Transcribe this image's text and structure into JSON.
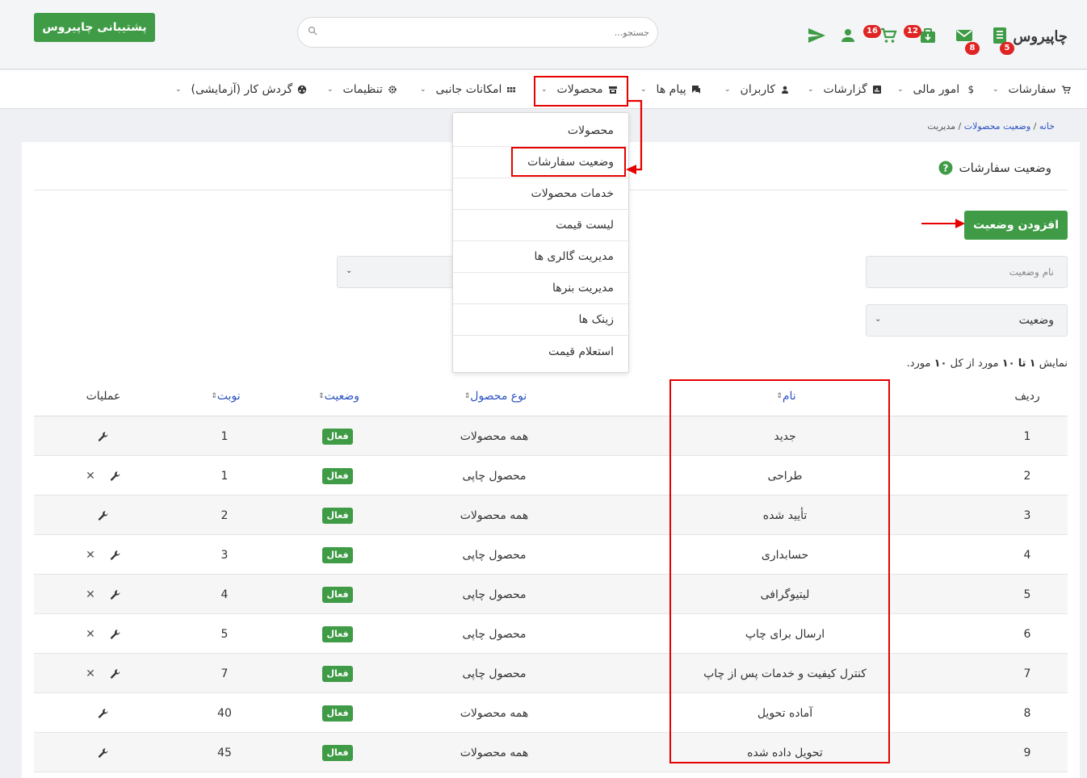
{
  "header": {
    "support_label": "پشتیبانی چاپیروس",
    "search_placeholder": "جستجو...",
    "logo_text": "چاپیروس",
    "badges": {
      "cart": "16",
      "orders_box": "12",
      "mail": "8",
      "invoices": "5"
    }
  },
  "nav": {
    "items": [
      {
        "label": "سفارشات"
      },
      {
        "label": "امور مالی"
      },
      {
        "label": "گزارشات"
      },
      {
        "label": "کاربران"
      },
      {
        "label": "پیام ها"
      },
      {
        "label": "محصولات"
      },
      {
        "label": "امکانات جانبی"
      },
      {
        "label": "تنظیمات"
      },
      {
        "label": "گردش کار (آزمایشی)"
      }
    ]
  },
  "dropdown": {
    "items": [
      {
        "label": "محصولات"
      },
      {
        "label": "وضعیت سفارشات"
      },
      {
        "label": "خدمات محصولات"
      },
      {
        "label": "لیست قیمت"
      },
      {
        "label": "مدیریت گالری ها"
      },
      {
        "label": "مدیریت بنرها"
      },
      {
        "label": "زینک ها"
      },
      {
        "label": "استعلام قیمت"
      }
    ]
  },
  "breadcrumb": {
    "home": "خانه",
    "section": "وضعیت محصولات",
    "current": "مدیریت",
    "sep": "/"
  },
  "page": {
    "title": "وضعیت سفارشات",
    "add_button": "افزودن وضعیت"
  },
  "filters": {
    "name_placeholder": "نام وضعیت",
    "status_label": "وضعیت"
  },
  "summary": {
    "prefix": "نمایش",
    "from": "۱",
    "to_word": "تا",
    "to": "۱۰",
    "mid": "مورد از کل",
    "total": "۱۰",
    "suffix": "مورد."
  },
  "table": {
    "headers": {
      "row": "ردیف",
      "name": "نام",
      "type": "نوع محصول",
      "status": "وضعیت",
      "turn": "نوبت",
      "ops": "عملیات"
    },
    "rows": [
      {
        "idx": "1",
        "name": "جدید",
        "type": "همه محصولات",
        "status": "فعال",
        "turn": "1",
        "deletable": false
      },
      {
        "idx": "2",
        "name": "طراحی",
        "type": "محصول چاپی",
        "status": "فعال",
        "turn": "1",
        "deletable": true
      },
      {
        "idx": "3",
        "name": "تأیید شده",
        "type": "همه محصولات",
        "status": "فعال",
        "turn": "2",
        "deletable": false
      },
      {
        "idx": "4",
        "name": "حسابداری",
        "type": "محصول چاپی",
        "status": "فعال",
        "turn": "3",
        "deletable": true
      },
      {
        "idx": "5",
        "name": "لیتیوگرافی",
        "type": "محصول چاپی",
        "status": "فعال",
        "turn": "4",
        "deletable": true
      },
      {
        "idx": "6",
        "name": "ارسال برای چاپ",
        "type": "محصول چاپی",
        "status": "فعال",
        "turn": "5",
        "deletable": true
      },
      {
        "idx": "7",
        "name": "کنترل کیفیت و خدمات پس از چاپ",
        "type": "محصول چاپی",
        "status": "فعال",
        "turn": "7",
        "deletable": true
      },
      {
        "idx": "8",
        "name": "آماده تحویل",
        "type": "همه محصولات",
        "status": "فعال",
        "turn": "40",
        "deletable": false
      },
      {
        "idx": "9",
        "name": "تحویل داده شده",
        "type": "همه محصولات",
        "status": "فعال",
        "turn": "45",
        "deletable": false
      }
    ]
  },
  "colors": {
    "primary_green": "#3f9b46",
    "highlight_red": "#e60000",
    "badge_red": "#e02424",
    "link_blue": "#2c54c4"
  }
}
